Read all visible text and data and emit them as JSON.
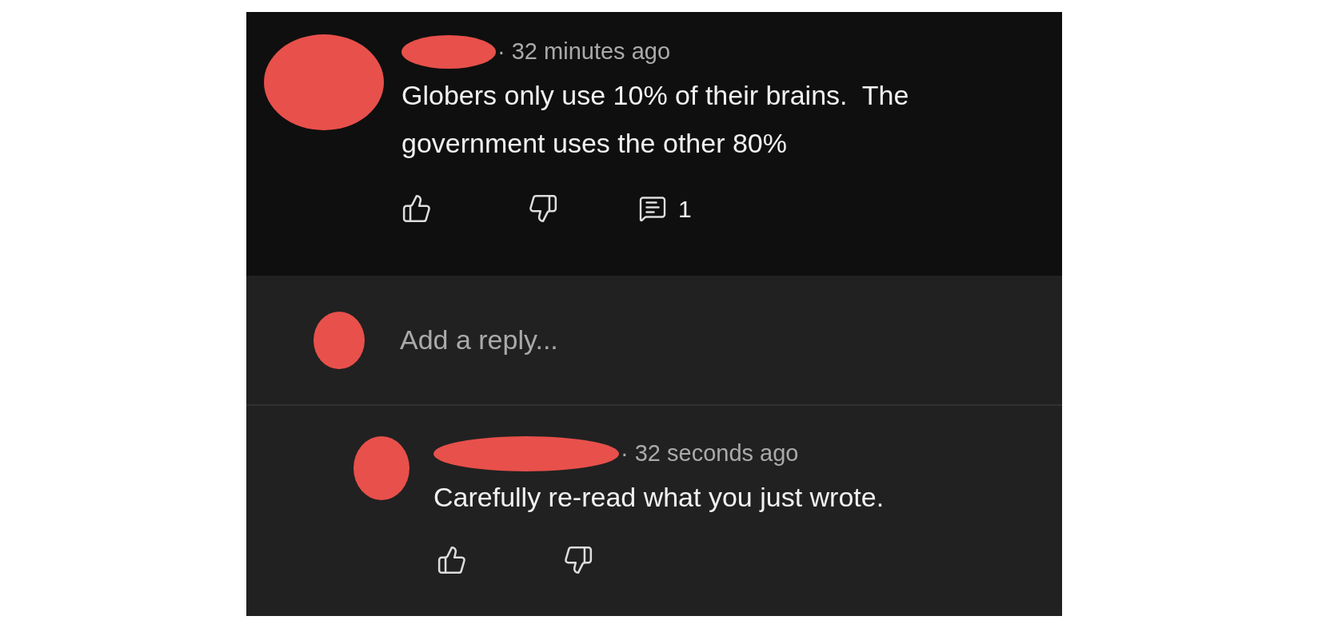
{
  "comment": {
    "time": "· 32 minutes ago",
    "text": "Globers only use 10% of their brains.  The government uses the other 80%",
    "reply_count": "1"
  },
  "reply_box": {
    "placeholder": "Add a reply..."
  },
  "reply": {
    "time": "· 32 seconds ago",
    "text": "Carefully re-read what you just wrote."
  }
}
